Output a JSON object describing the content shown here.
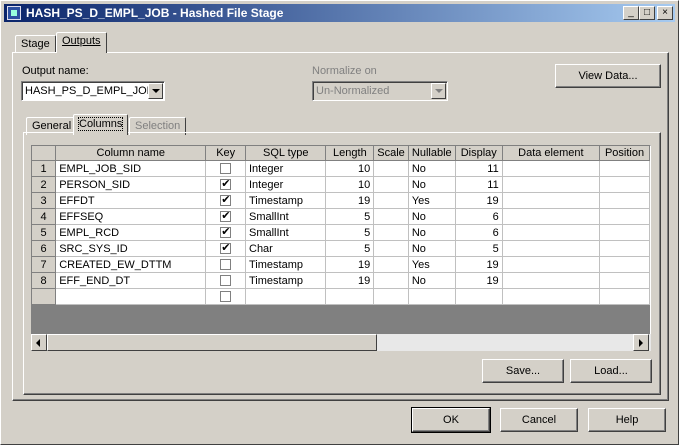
{
  "window": {
    "title": "HASH_PS_D_EMPL_JOB - Hashed File Stage",
    "buttons": {
      "minimize": "_",
      "maximize": "□",
      "close": "×"
    }
  },
  "top_tabs": [
    {
      "label": "Stage",
      "active": false
    },
    {
      "label": "Outputs",
      "active": true
    }
  ],
  "output_name": {
    "label": "Output name:",
    "value": "HASH_PS_D_EMPL_JOB"
  },
  "normalize": {
    "label": "Normalize on",
    "value": "Un-Normalized"
  },
  "view_data_label": "View Data...",
  "inner_tabs": [
    {
      "label": "General",
      "active": false,
      "disabled": false
    },
    {
      "label": "Columns",
      "active": true,
      "disabled": false
    },
    {
      "label": "Selection",
      "active": false,
      "disabled": true
    }
  ],
  "grid": {
    "columns": [
      "Column name",
      "Key",
      "SQL type",
      "Length",
      "Scale",
      "Nullable",
      "Display",
      "Data element",
      "Position"
    ],
    "rows": [
      {
        "n": "1",
        "name": "EMPL_JOB_SID",
        "key": false,
        "type": "Integer",
        "length": "10",
        "scale": "",
        "nullable": "No",
        "display": "11",
        "element": "",
        "position": ""
      },
      {
        "n": "2",
        "name": "PERSON_SID",
        "key": true,
        "type": "Integer",
        "length": "10",
        "scale": "",
        "nullable": "No",
        "display": "11",
        "element": "",
        "position": ""
      },
      {
        "n": "3",
        "name": "EFFDT",
        "key": true,
        "type": "Timestamp",
        "length": "19",
        "scale": "",
        "nullable": "Yes",
        "display": "19",
        "element": "",
        "position": ""
      },
      {
        "n": "4",
        "name": "EFFSEQ",
        "key": true,
        "type": "SmallInt",
        "length": "5",
        "scale": "",
        "nullable": "No",
        "display": "6",
        "element": "",
        "position": ""
      },
      {
        "n": "5",
        "name": "EMPL_RCD",
        "key": true,
        "type": "SmallInt",
        "length": "5",
        "scale": "",
        "nullable": "No",
        "display": "6",
        "element": "",
        "position": ""
      },
      {
        "n": "6",
        "name": "SRC_SYS_ID",
        "key": true,
        "type": "Char",
        "length": "5",
        "scale": "",
        "nullable": "No",
        "display": "5",
        "element": "",
        "position": ""
      },
      {
        "n": "7",
        "name": "CREATED_EW_DTTM",
        "key": false,
        "type": "Timestamp",
        "length": "19",
        "scale": "",
        "nullable": "Yes",
        "display": "19",
        "element": "",
        "position": ""
      },
      {
        "n": "8",
        "name": "EFF_END_DT",
        "key": false,
        "type": "Timestamp",
        "length": "19",
        "scale": "",
        "nullable": "No",
        "display": "19",
        "element": "",
        "position": ""
      }
    ]
  },
  "buttons": {
    "save": "Save...",
    "load": "Load...",
    "ok": "OK",
    "cancel": "Cancel",
    "help": "Help"
  }
}
